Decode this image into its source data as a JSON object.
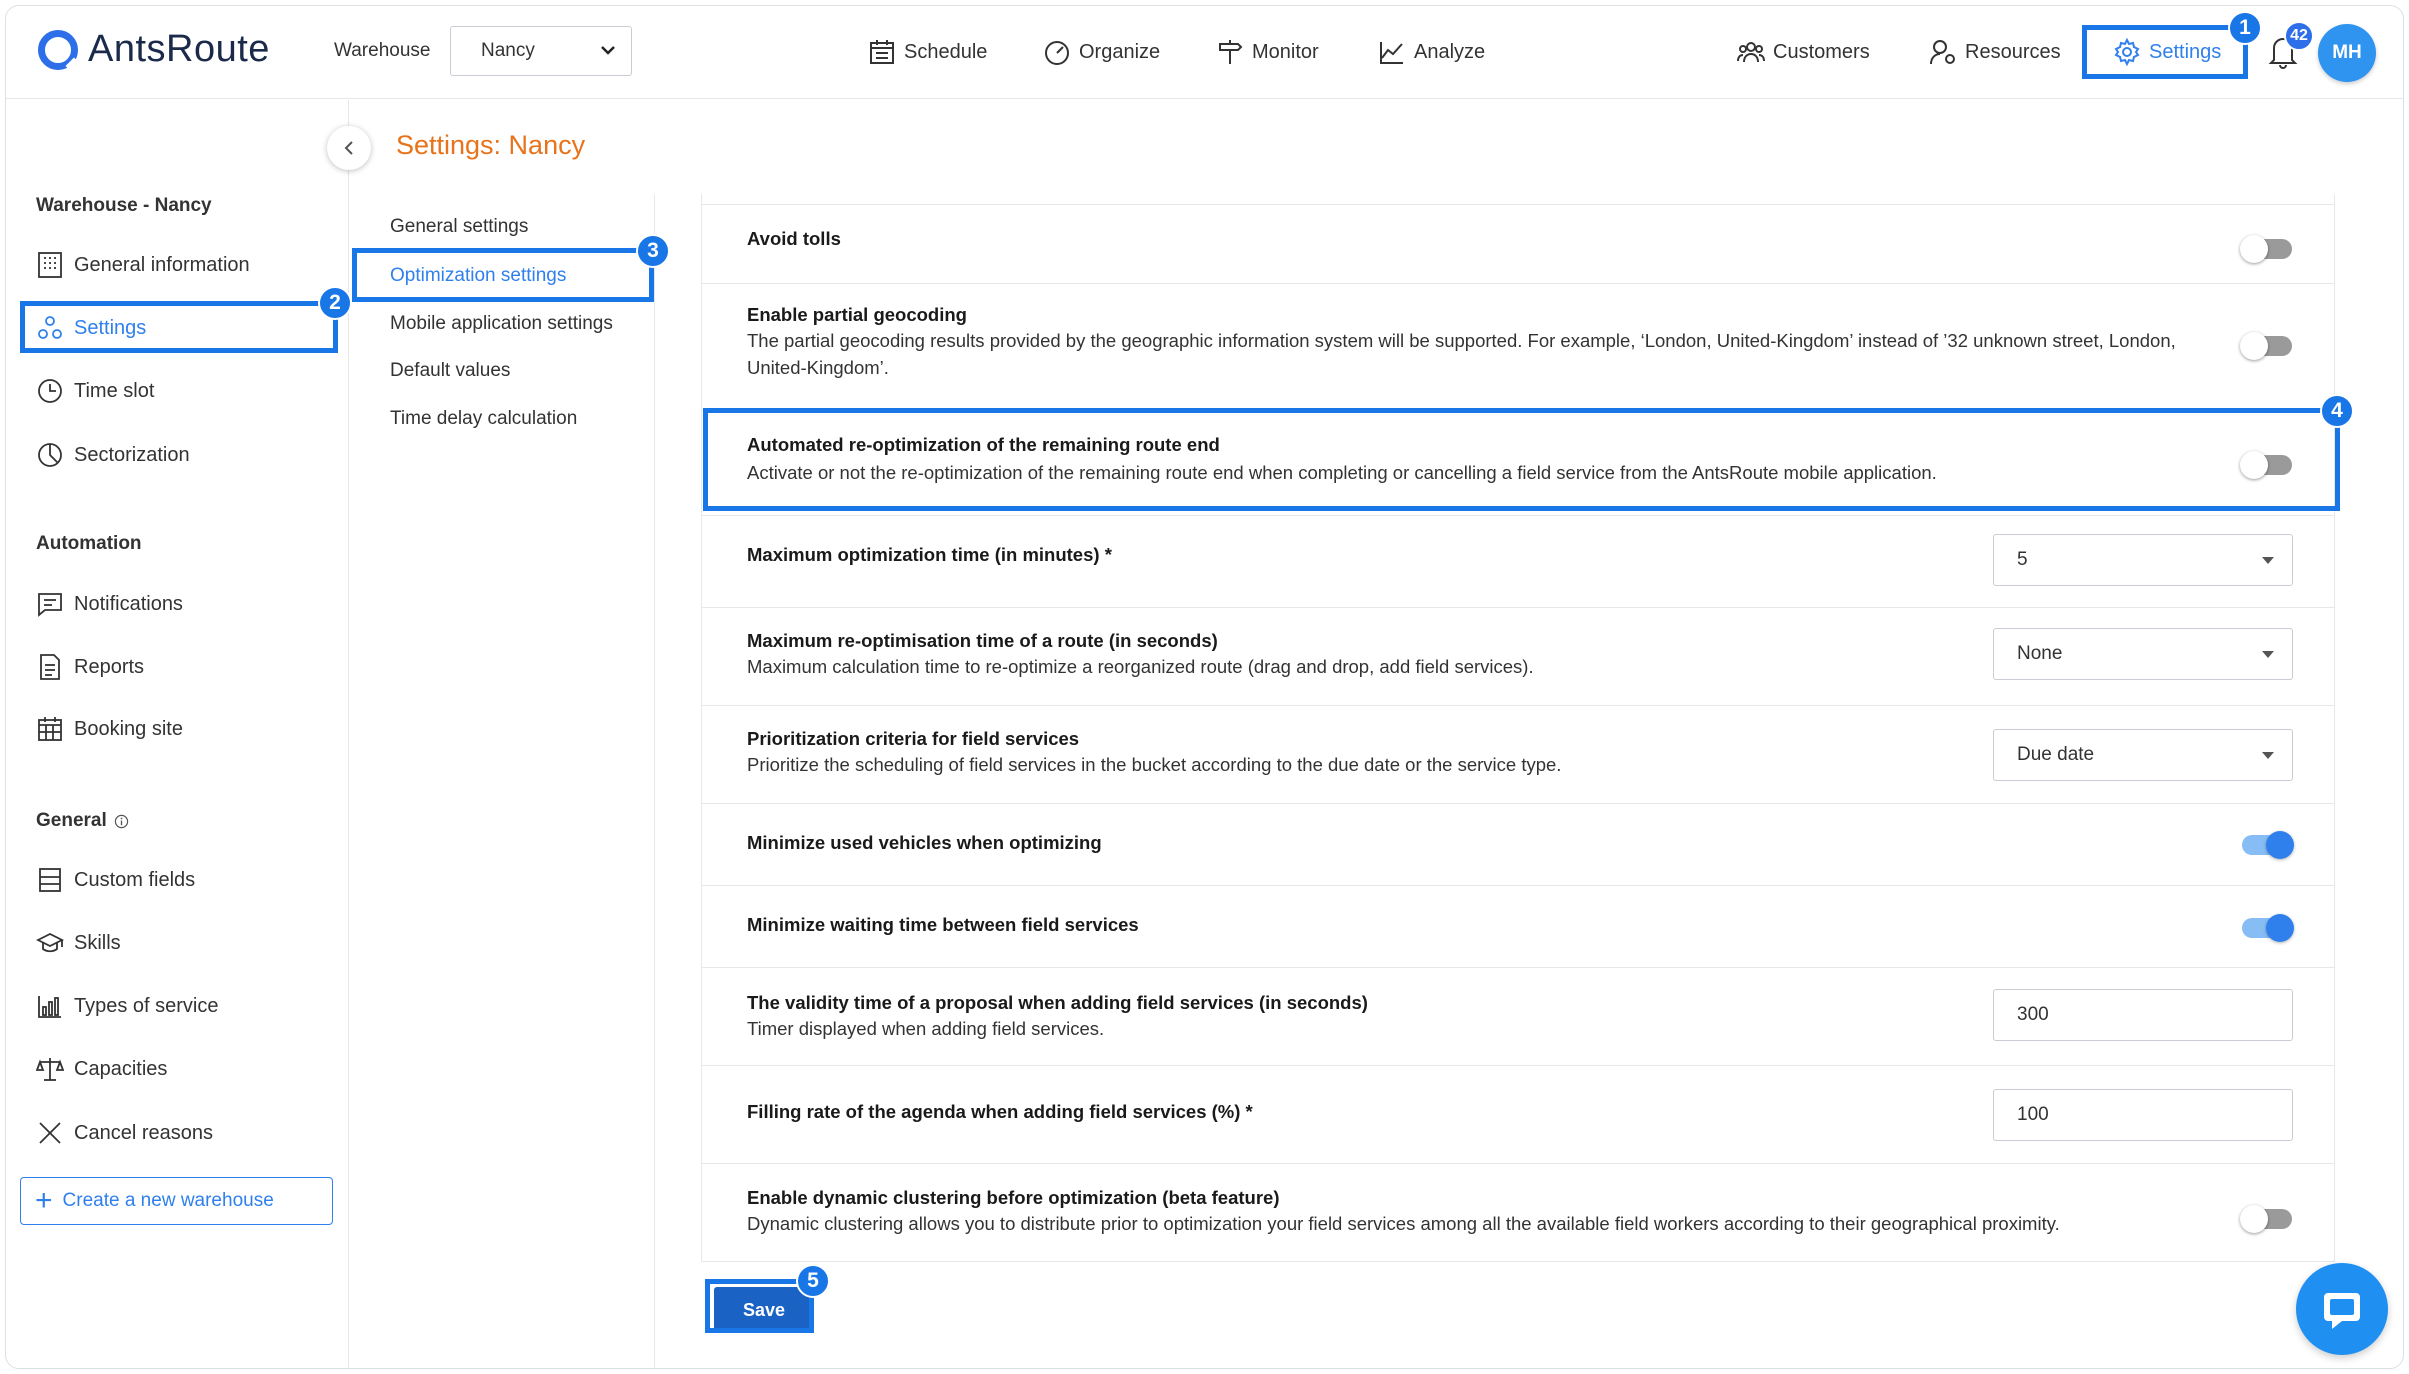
{
  "header": {
    "logo_brand": "AntsRoute",
    "warehouse_label": "Warehouse",
    "warehouse_value": "Nancy",
    "nav": {
      "schedule": "Schedule",
      "organize": "Organize",
      "monitor": "Monitor",
      "analyze": "Analyze",
      "customers": "Customers",
      "resources": "Resources",
      "settings": "Settings"
    },
    "notification_count": "42",
    "avatar_initials": "MH"
  },
  "page_title": "Settings: Nancy",
  "sidebar": {
    "section_warehouse": "Warehouse - Nancy",
    "general_information": "General information",
    "settings": "Settings",
    "time_slot": "Time slot",
    "sectorization": "Sectorization",
    "section_automation": "Automation",
    "notifications": "Notifications",
    "reports": "Reports",
    "booking_site": "Booking site",
    "section_general": "General",
    "custom_fields": "Custom fields",
    "skills": "Skills",
    "types_of_service": "Types of service",
    "capacities": "Capacities",
    "cancel_reasons": "Cancel reasons",
    "create_warehouse": "Create a new warehouse"
  },
  "subnav": {
    "general_settings": "General settings",
    "optimization_settings": "Optimization settings",
    "mobile_application_settings": "Mobile application settings",
    "default_values": "Default values",
    "time_delay_calculation": "Time delay calculation"
  },
  "settings": {
    "avoid_tolls": {
      "title": "Avoid tolls",
      "enabled": false
    },
    "partial_geocoding": {
      "title": "Enable partial geocoding",
      "desc": "The partial geocoding results provided by the geographic information system will be supported. For example, ‘London, United-Kingdom’ instead of ’32 unknown street, London, United-Kingdom’.",
      "enabled": false
    },
    "auto_reoptimization": {
      "title": "Automated re-optimization of the remaining route end",
      "desc": "Activate or not the re-optimization of the remaining route end when completing or cancelling a field service from the AntsRoute mobile application.",
      "enabled": false
    },
    "max_optimization_time": {
      "title": "Maximum optimization time (in minutes) *",
      "value": "5"
    },
    "max_reoptimisation_time": {
      "title": "Maximum re-optimisation time of a route (in seconds)",
      "desc": "Maximum calculation time to re-optimize a reorganized route (drag and drop, add field services).",
      "value": "None"
    },
    "prioritization": {
      "title": "Prioritization criteria for field services",
      "desc": "Prioritize the scheduling of field services in the bucket according to the due date or the service type.",
      "value": "Due date"
    },
    "minimize_vehicles": {
      "title": "Minimize used vehicles when optimizing",
      "enabled": true
    },
    "minimize_waiting": {
      "title": "Minimize waiting time between field services",
      "enabled": true
    },
    "validity_time": {
      "title": "The validity time of a proposal when adding field services (in seconds)",
      "desc": "Timer displayed when adding field services.",
      "value": "300"
    },
    "filling_rate": {
      "title": "Filling rate of the agenda when adding field services (%) *",
      "value": "100"
    },
    "dynamic_clustering": {
      "title": "Enable dynamic clustering before optimization (beta feature)",
      "desc": "Dynamic clustering allows you to distribute prior to optimization your field services among all the available field workers according to their geographical proximity.",
      "enabled": false
    }
  },
  "save_label": "Save",
  "steps": {
    "s1": "1",
    "s2": "2",
    "s3": "3",
    "s4": "4",
    "s5": "5"
  },
  "colors": {
    "accent": "#2f80ed",
    "highlight": "#1976e6",
    "title_orange": "#e8731a",
    "save": "#1a63c5"
  }
}
